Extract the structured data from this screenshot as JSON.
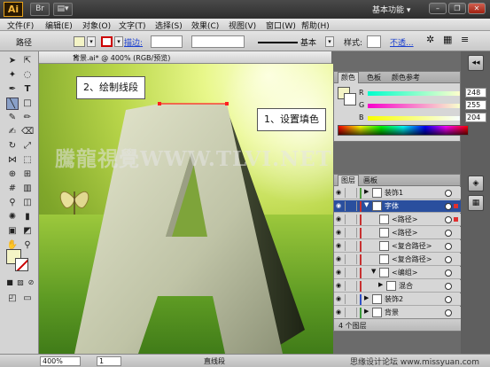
{
  "app": {
    "logo": "Ai",
    "workspace": "基本功能 ▾"
  },
  "menu": [
    "文件(F)",
    "编辑(E)",
    "对象(O)",
    "文字(T)",
    "选择(S)",
    "效果(C)",
    "视图(V)",
    "窗口(W)",
    "帮助(H)"
  ],
  "control_bar": {
    "object_type": "路径",
    "stroke_label": "描边:",
    "brush_label": "基本",
    "style_label": "样式:",
    "opacity_label": "不透...",
    "colors": {
      "fill": "#f4f4c6",
      "stroke": "#cc0000"
    }
  },
  "document": {
    "tab_title": "背景.ai* @ 400% (RGB/预览)",
    "close_glyph": "×"
  },
  "canvas": {
    "callout_draw": "2、绘制线段",
    "callout_fill": "1、设置填色",
    "watermark": "騰龍視覺WWW.TLVI.NET"
  },
  "status": {
    "zoom": "400%",
    "page": "1",
    "tool": "直线段",
    "site_watermark": "思缘设计论坛 www.missyuan.com"
  },
  "color_panel": {
    "tabs": [
      "颜色",
      "色板",
      "颜色参考"
    ],
    "channels": [
      {
        "letter": "R",
        "value": "248"
      },
      {
        "letter": "G",
        "value": "255"
      },
      {
        "letter": "B",
        "value": "204"
      }
    ]
  },
  "layers_panel": {
    "tabs": [
      "图层",
      "画板"
    ],
    "rows": [
      {
        "name": "装饰1",
        "color": "#4a9a3a",
        "indent": 0,
        "twisty": "▶",
        "selected": false,
        "sel_color": ""
      },
      {
        "name": "字体",
        "color": "#c83030",
        "indent": 0,
        "twisty": "▼",
        "selected": true,
        "sel_color": "#e03030"
      },
      {
        "name": "<路径>",
        "color": "#c83030",
        "indent": 1,
        "twisty": "",
        "selected": false,
        "sel_color": "#e03030"
      },
      {
        "name": "<路径>",
        "color": "#c83030",
        "indent": 1,
        "twisty": "",
        "selected": false,
        "sel_color": ""
      },
      {
        "name": "<复合路径>",
        "color": "#c83030",
        "indent": 1,
        "twisty": "",
        "selected": false,
        "sel_color": ""
      },
      {
        "name": "<复合路径>",
        "color": "#c83030",
        "indent": 1,
        "twisty": "",
        "selected": false,
        "sel_color": ""
      },
      {
        "name": "<编组>",
        "color": "#c83030",
        "indent": 1,
        "twisty": "▼",
        "selected": false,
        "sel_color": ""
      },
      {
        "name": "混合",
        "color": "#c83030",
        "indent": 2,
        "twisty": "▶",
        "selected": false,
        "sel_color": ""
      },
      {
        "name": "装饰2",
        "color": "#3050c8",
        "indent": 0,
        "twisty": "▶",
        "selected": false,
        "sel_color": ""
      },
      {
        "name": "背景",
        "color": "#3a9a3a",
        "indent": 0,
        "twisty": "▶",
        "selected": false,
        "sel_color": ""
      }
    ],
    "footer": "4 个图层"
  }
}
